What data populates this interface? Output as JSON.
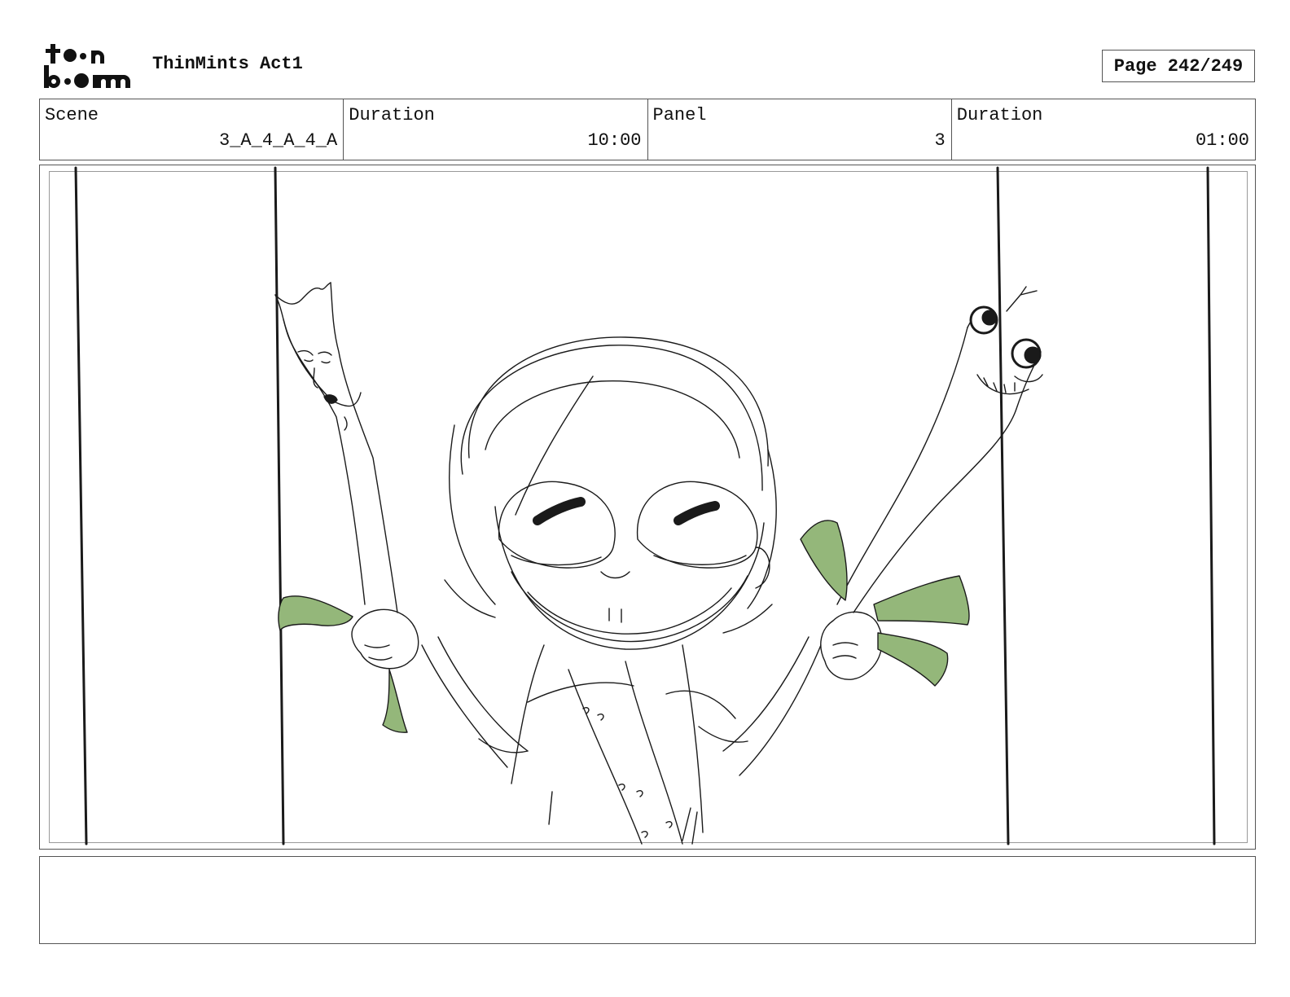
{
  "header": {
    "logo_text": "toonboom",
    "project_title": "ThinMints Act1",
    "page_label": "Page 242/249"
  },
  "info": {
    "scene_label": "Scene",
    "scene_value": "3_A_4_A_4_A",
    "scene_duration_label": "Duration",
    "scene_duration_value": "10:00",
    "panel_label": "Panel",
    "panel_value": "3",
    "panel_duration_label": "Duration",
    "panel_duration_value": "01:00"
  },
  "colors": {
    "accent_green": "#94b77a",
    "line": "#1a1a1a"
  },
  "notes": {
    "text": ""
  }
}
